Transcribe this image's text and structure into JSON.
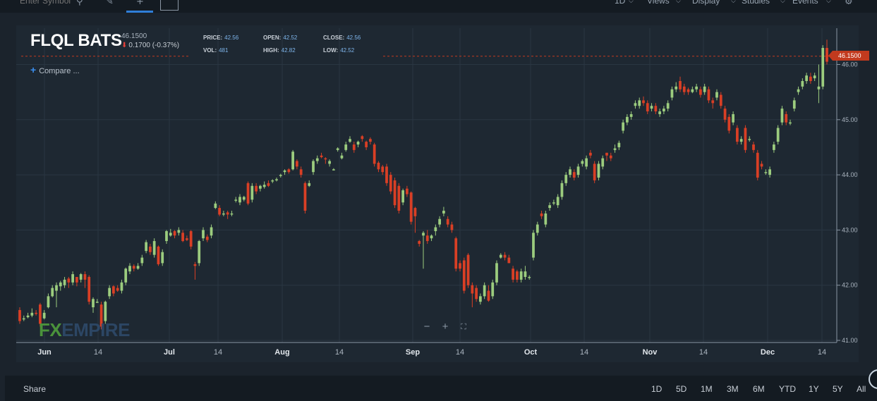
{
  "toolbar": {
    "symbol_placeholder": "Enter Symbol",
    "menus": [
      {
        "label": "1D",
        "x": 871
      },
      {
        "label": "Views",
        "x": 917
      },
      {
        "label": "Display",
        "x": 981
      },
      {
        "label": "Studies",
        "x": 1051
      },
      {
        "label": "Events",
        "x": 1123
      }
    ]
  },
  "header": {
    "symbol": "FLQL BATS",
    "last_price": "46.1500",
    "change": "0.1700 (-0.37%)"
  },
  "stats": {
    "price_label": "PRICE:",
    "price": "42.56",
    "open_label": "OPEN:",
    "open": "42.52",
    "close_label": "CLOSE:",
    "close": "42.56",
    "vol_label": "VOL:",
    "vol": "481",
    "high_label": "HIGH:",
    "high": "42.82",
    "low_label": "LOW:",
    "low": "42.52"
  },
  "compare_label": "Compare ...",
  "watermark": {
    "fx": "FX",
    "empire": "EMPIRE"
  },
  "price_tag": "46.1500",
  "bottom": {
    "share": "Share",
    "ranges": [
      "1D",
      "5D",
      "1M",
      "3M",
      "6M",
      "YTD",
      "1Y",
      "5Y",
      "All"
    ]
  },
  "colors": {
    "up": "#9ccc7e",
    "down": "#d93f25",
    "grid": "#2a3642",
    "background": "#1e2832"
  },
  "chart_data": {
    "type": "candlestick",
    "ylim": [
      41.0,
      46.5
    ],
    "y_ticks": [
      "41.00",
      "42.00",
      "43.00",
      "44.00",
      "45.00",
      "46.00"
    ],
    "x_tick_labels": [
      "Jun",
      "14",
      "Jul",
      "14",
      "Aug",
      "14",
      "Sep",
      "14",
      "Oct",
      "14",
      "Nov",
      "14",
      "Dec",
      "14"
    ],
    "last_price_line": 46.15,
    "candles": [
      [
        41.55,
        41.35,
        41.6,
        41.3
      ],
      [
        41.38,
        41.4,
        41.45,
        41.35
      ],
      [
        41.42,
        41.45,
        41.5,
        41.4
      ],
      [
        41.45,
        41.5,
        41.58,
        41.42
      ],
      [
        41.5,
        41.48,
        41.55,
        41.45
      ],
      [
        41.65,
        41.3,
        41.68,
        41.25
      ],
      [
        41.4,
        41.5,
        41.55,
        41.38
      ],
      [
        41.6,
        41.8,
        41.85,
        41.58
      ],
      [
        41.8,
        41.95,
        42.0,
        41.78
      ],
      [
        41.9,
        42.0,
        42.05,
        41.6
      ],
      [
        41.98,
        42.05,
        42.08,
        41.9
      ],
      [
        42.0,
        42.1,
        42.15,
        41.95
      ],
      [
        42.12,
        42.05,
        42.15,
        41.95
      ],
      [
        42.05,
        42.2,
        42.25,
        42.0
      ],
      [
        42.15,
        42.05,
        42.15,
        41.98
      ],
      [
        42.1,
        42.2,
        42.22,
        42.05
      ],
      [
        42.2,
        42.1,
        42.25,
        41.95
      ],
      [
        42.15,
        41.7,
        42.18,
        41.65
      ],
      [
        41.6,
        41.75,
        41.78,
        41.5
      ],
      [
        41.7,
        41.7,
        41.75,
        41.68
      ],
      [
        41.65,
        41.25,
        41.7,
        41.2
      ],
      [
        41.35,
        41.7,
        41.72,
        41.3
      ],
      [
        41.8,
        41.95,
        42.0,
        41.75
      ],
      [
        41.98,
        41.85,
        42.0,
        41.8
      ],
      [
        41.95,
        41.9,
        42.0,
        41.88
      ],
      [
        41.9,
        42.05,
        42.1,
        41.85
      ],
      [
        42.05,
        42.3,
        42.32,
        42.0
      ],
      [
        42.25,
        42.35,
        42.4,
        42.2
      ],
      [
        42.35,
        42.3,
        42.38,
        42.25
      ],
      [
        42.3,
        42.35,
        42.4,
        42.28
      ],
      [
        42.4,
        42.5,
        42.55,
        42.35
      ],
      [
        42.62,
        42.78,
        42.82,
        42.58
      ],
      [
        42.7,
        42.6,
        42.75,
        42.55
      ],
      [
        42.55,
        42.8,
        42.85,
        42.5
      ],
      [
        42.7,
        42.38,
        42.72,
        42.35
      ],
      [
        42.4,
        42.6,
        42.65,
        42.35
      ],
      [
        42.8,
        42.98,
        43.0,
        42.75
      ],
      [
        42.9,
        42.95,
        43.02,
        42.88
      ],
      [
        42.98,
        42.9,
        43.0,
        42.85
      ],
      [
        42.95,
        43.0,
        43.05,
        42.9
      ],
      [
        42.95,
        42.8,
        43.0,
        42.78
      ],
      [
        42.85,
        42.82,
        42.9,
        42.8
      ],
      [
        42.98,
        42.7,
        43.0,
        42.65
      ],
      [
        42.38,
        42.35,
        42.42,
        42.1
      ],
      [
        42.4,
        42.8,
        42.82,
        42.35
      ],
      [
        42.85,
        43.0,
        43.05,
        42.8
      ],
      [
        42.88,
        42.82,
        42.92,
        42.78
      ],
      [
        42.9,
        43.05,
        43.1,
        42.85
      ],
      [
        43.4,
        43.48,
        43.52,
        43.38
      ],
      [
        43.4,
        43.28,
        43.45,
        43.25
      ],
      [
        43.3,
        43.3,
        43.35,
        43.25
      ],
      [
        43.32,
        43.28,
        43.35,
        43.2
      ],
      [
        43.3,
        43.3,
        43.35,
        43.25
      ],
      [
        43.55,
        43.55,
        43.6,
        43.5
      ],
      [
        43.5,
        43.6,
        43.65,
        43.45
      ],
      [
        43.55,
        43.6,
        43.62,
        43.52
      ],
      [
        43.85,
        43.48,
        43.88,
        43.45
      ],
      [
        43.55,
        43.8,
        43.85,
        43.5
      ],
      [
        43.8,
        43.7,
        43.85,
        43.65
      ],
      [
        43.75,
        43.8,
        43.82,
        43.7
      ],
      [
        43.78,
        43.82,
        43.88,
        43.75
      ],
      [
        43.85,
        43.8,
        43.9,
        43.78
      ],
      [
        43.88,
        43.9,
        43.92,
        43.85
      ],
      [
        43.9,
        43.92,
        43.95,
        43.88
      ],
      [
        43.98,
        44.0,
        44.02,
        43.95
      ],
      [
        44.05,
        44.08,
        44.1,
        44.0
      ],
      [
        44.1,
        44.05,
        44.12,
        44.02
      ],
      [
        44.1,
        44.42,
        44.45,
        44.08
      ],
      [
        44.25,
        44.15,
        44.28,
        44.1
      ],
      [
        44.1,
        44.0,
        44.15,
        43.95
      ],
      [
        43.85,
        43.35,
        43.88,
        43.3
      ],
      [
        43.8,
        43.85,
        43.9,
        43.78
      ],
      [
        44.05,
        44.25,
        44.28,
        44.0
      ],
      [
        44.25,
        44.3,
        44.35,
        44.2
      ],
      [
        44.35,
        44.32,
        44.4,
        44.3
      ],
      [
        44.3,
        44.28,
        44.32,
        44.2
      ],
      [
        44.2,
        44.25,
        44.28,
        44.15
      ],
      [
        44.1,
        44.1,
        44.12,
        44.08
      ],
      [
        44.45,
        44.48,
        44.5,
        44.42
      ],
      [
        44.3,
        44.35,
        44.4,
        44.28
      ],
      [
        44.45,
        44.55,
        44.6,
        44.42
      ],
      [
        44.6,
        44.65,
        44.7,
        44.58
      ],
      [
        44.55,
        44.45,
        44.6,
        44.4
      ],
      [
        44.55,
        44.6,
        44.62,
        44.5
      ],
      [
        44.7,
        44.65,
        44.72,
        44.6
      ],
      [
        44.6,
        44.5,
        44.62,
        44.45
      ],
      [
        44.65,
        44.6,
        44.68,
        44.55
      ],
      [
        44.55,
        44.2,
        44.58,
        44.15
      ],
      [
        44.22,
        44.1,
        44.25,
        44.05
      ],
      [
        44.15,
        44.05,
        44.18,
        44.0
      ],
      [
        44.15,
        43.85,
        44.2,
        43.8
      ],
      [
        44.0,
        43.7,
        44.05,
        43.65
      ],
      [
        43.9,
        43.45,
        43.95,
        43.4
      ],
      [
        43.8,
        43.35,
        43.85,
        43.3
      ],
      [
        43.5,
        43.72,
        43.75,
        43.45
      ],
      [
        43.75,
        43.65,
        43.8,
        43.6
      ],
      [
        43.68,
        43.15,
        43.7,
        43.1
      ],
      [
        43.4,
        43.25,
        43.42,
        42.95
      ],
      [
        42.8,
        42.75,
        42.82,
        42.7
      ],
      [
        42.9,
        42.95,
        42.98,
        42.3
      ],
      [
        42.9,
        42.8,
        43.0,
        42.75
      ],
      [
        42.85,
        42.9,
        42.92,
        42.8
      ],
      [
        42.98,
        43.05,
        43.1,
        42.9
      ],
      [
        43.1,
        43.2,
        43.25,
        43.05
      ],
      [
        43.3,
        43.35,
        43.42,
        43.25
      ],
      [
        43.2,
        43.1,
        43.25,
        43.05
      ],
      [
        43.1,
        43.0,
        43.15,
        42.95
      ],
      [
        42.85,
        42.3,
        42.88,
        42.25
      ],
      [
        42.4,
        42.3,
        42.45,
        42.25
      ],
      [
        42.45,
        41.9,
        42.5,
        41.85
      ],
      [
        42.55,
        42.0,
        42.58,
        41.95
      ],
      [
        42.0,
        41.85,
        42.05,
        41.6
      ],
      [
        41.95,
        41.75,
        42.0,
        41.7
      ],
      [
        41.7,
        41.8,
        41.85,
        41.65
      ],
      [
        41.8,
        42.0,
        42.05,
        41.75
      ],
      [
        41.9,
        41.72,
        42.0,
        41.7
      ],
      [
        41.8,
        42.05,
        42.1,
        41.75
      ],
      [
        42.05,
        42.4,
        42.45,
        42.0
      ],
      [
        42.5,
        42.55,
        42.58,
        42.48
      ],
      [
        42.55,
        42.5,
        42.6,
        42.45
      ],
      [
        42.5,
        42.4,
        42.55,
        42.4
      ],
      [
        42.3,
        42.1,
        42.35,
        42.05
      ],
      [
        42.25,
        42.1,
        42.28,
        42.05
      ],
      [
        42.1,
        42.25,
        42.3,
        42.05
      ],
      [
        42.15,
        42.25,
        42.35,
        42.1
      ],
      [
        42.15,
        42.15,
        42.18,
        42.1
      ],
      [
        42.5,
        42.95,
        43.0,
        42.45
      ],
      [
        42.95,
        43.1,
        43.15,
        42.9
      ],
      [
        43.3,
        43.25,
        43.35,
        43.2
      ],
      [
        43.1,
        43.3,
        43.35,
        43.05
      ],
      [
        43.4,
        43.45,
        43.5,
        43.35
      ],
      [
        43.5,
        43.5,
        43.55,
        43.45
      ],
      [
        43.45,
        43.6,
        43.65,
        43.4
      ],
      [
        43.6,
        43.85,
        43.9,
        43.55
      ],
      [
        43.85,
        44.0,
        44.05,
        43.8
      ],
      [
        44.0,
        44.1,
        44.15,
        43.95
      ],
      [
        44.05,
        43.95,
        44.1,
        43.9
      ],
      [
        44.0,
        44.15,
        44.2,
        43.95
      ],
      [
        44.2,
        44.25,
        44.28,
        44.15
      ],
      [
        44.15,
        44.3,
        44.35,
        44.1
      ],
      [
        44.4,
        44.35,
        44.45,
        44.3
      ],
      [
        44.2,
        43.9,
        44.25,
        43.85
      ],
      [
        43.95,
        44.2,
        44.25,
        43.9
      ],
      [
        44.15,
        44.3,
        44.35,
        44.1
      ],
      [
        44.4,
        44.35,
        44.4,
        44.25
      ],
      [
        44.35,
        44.3,
        44.4,
        44.25
      ],
      [
        44.45,
        44.48,
        44.55,
        44.4
      ],
      [
        44.5,
        44.58,
        44.62,
        44.45
      ],
      [
        44.8,
        44.95,
        45.0,
        44.75
      ],
      [
        44.95,
        45.05,
        45.1,
        44.9
      ],
      [
        45.05,
        45.1,
        45.15,
        45.0
      ],
      [
        45.25,
        45.3,
        45.35,
        45.2
      ],
      [
        45.25,
        45.35,
        45.4,
        45.2
      ],
      [
        45.35,
        45.3,
        45.42,
        45.25
      ],
      [
        45.3,
        45.15,
        45.35,
        45.1
      ],
      [
        45.2,
        45.25,
        45.3,
        45.15
      ],
      [
        45.25,
        45.15,
        45.3,
        45.1
      ],
      [
        45.1,
        45.15,
        45.2,
        45.05
      ],
      [
        45.15,
        45.2,
        45.25,
        45.1
      ],
      [
        45.2,
        45.3,
        45.35,
        45.15
      ],
      [
        45.4,
        45.55,
        45.6,
        45.35
      ],
      [
        45.55,
        45.6,
        45.68,
        45.5
      ],
      [
        45.7,
        45.55,
        45.78,
        45.5
      ],
      [
        45.6,
        45.5,
        45.65,
        45.45
      ],
      [
        45.55,
        45.5,
        45.58,
        45.45
      ],
      [
        45.5,
        45.55,
        45.6,
        45.48
      ],
      [
        45.55,
        45.6,
        45.65,
        45.5
      ],
      [
        45.55,
        45.45,
        45.6,
        45.4
      ],
      [
        45.5,
        45.6,
        45.65,
        45.45
      ],
      [
        45.55,
        45.35,
        45.6,
        45.3
      ],
      [
        45.35,
        45.3,
        45.4,
        45.2
      ],
      [
        45.4,
        45.5,
        45.55,
        45.35
      ],
      [
        45.45,
        45.25,
        45.5,
        45.2
      ],
      [
        45.2,
        45.0,
        45.25,
        44.95
      ],
      [
        45.05,
        44.8,
        45.1,
        44.75
      ],
      [
        44.95,
        45.1,
        45.15,
        44.9
      ],
      [
        44.85,
        44.6,
        44.9,
        44.55
      ],
      [
        44.6,
        44.65,
        44.7,
        44.55
      ],
      [
        44.85,
        44.45,
        44.9,
        44.4
      ],
      [
        44.65,
        44.65,
        44.7,
        44.6
      ],
      [
        44.55,
        44.45,
        44.6,
        44.4
      ],
      [
        44.4,
        43.95,
        44.45,
        43.9
      ],
      [
        44.2,
        44.15,
        44.25,
        44.1
      ],
      [
        44.05,
        44.05,
        44.1,
        44.0
      ],
      [
        44.0,
        44.1,
        44.15,
        43.95
      ],
      [
        44.45,
        44.55,
        44.6,
        44.4
      ],
      [
        44.6,
        44.85,
        44.9,
        44.55
      ],
      [
        44.95,
        45.2,
        45.25,
        44.9
      ],
      [
        45.1,
        44.95,
        45.15,
        44.9
      ],
      [
        44.95,
        44.95,
        45.0,
        44.9
      ],
      [
        45.2,
        45.35,
        45.4,
        45.15
      ],
      [
        45.5,
        45.55,
        45.6,
        45.45
      ],
      [
        45.6,
        45.7,
        45.75,
        45.55
      ],
      [
        45.7,
        45.8,
        45.85,
        45.65
      ],
      [
        45.78,
        45.7,
        45.85,
        45.65
      ],
      [
        45.75,
        45.8,
        45.85,
        45.7
      ],
      [
        45.55,
        45.6,
        46.0,
        45.3
      ],
      [
        45.6,
        46.3,
        46.35,
        45.55
      ],
      [
        46.3,
        46.05,
        46.45,
        46.0
      ]
    ]
  }
}
